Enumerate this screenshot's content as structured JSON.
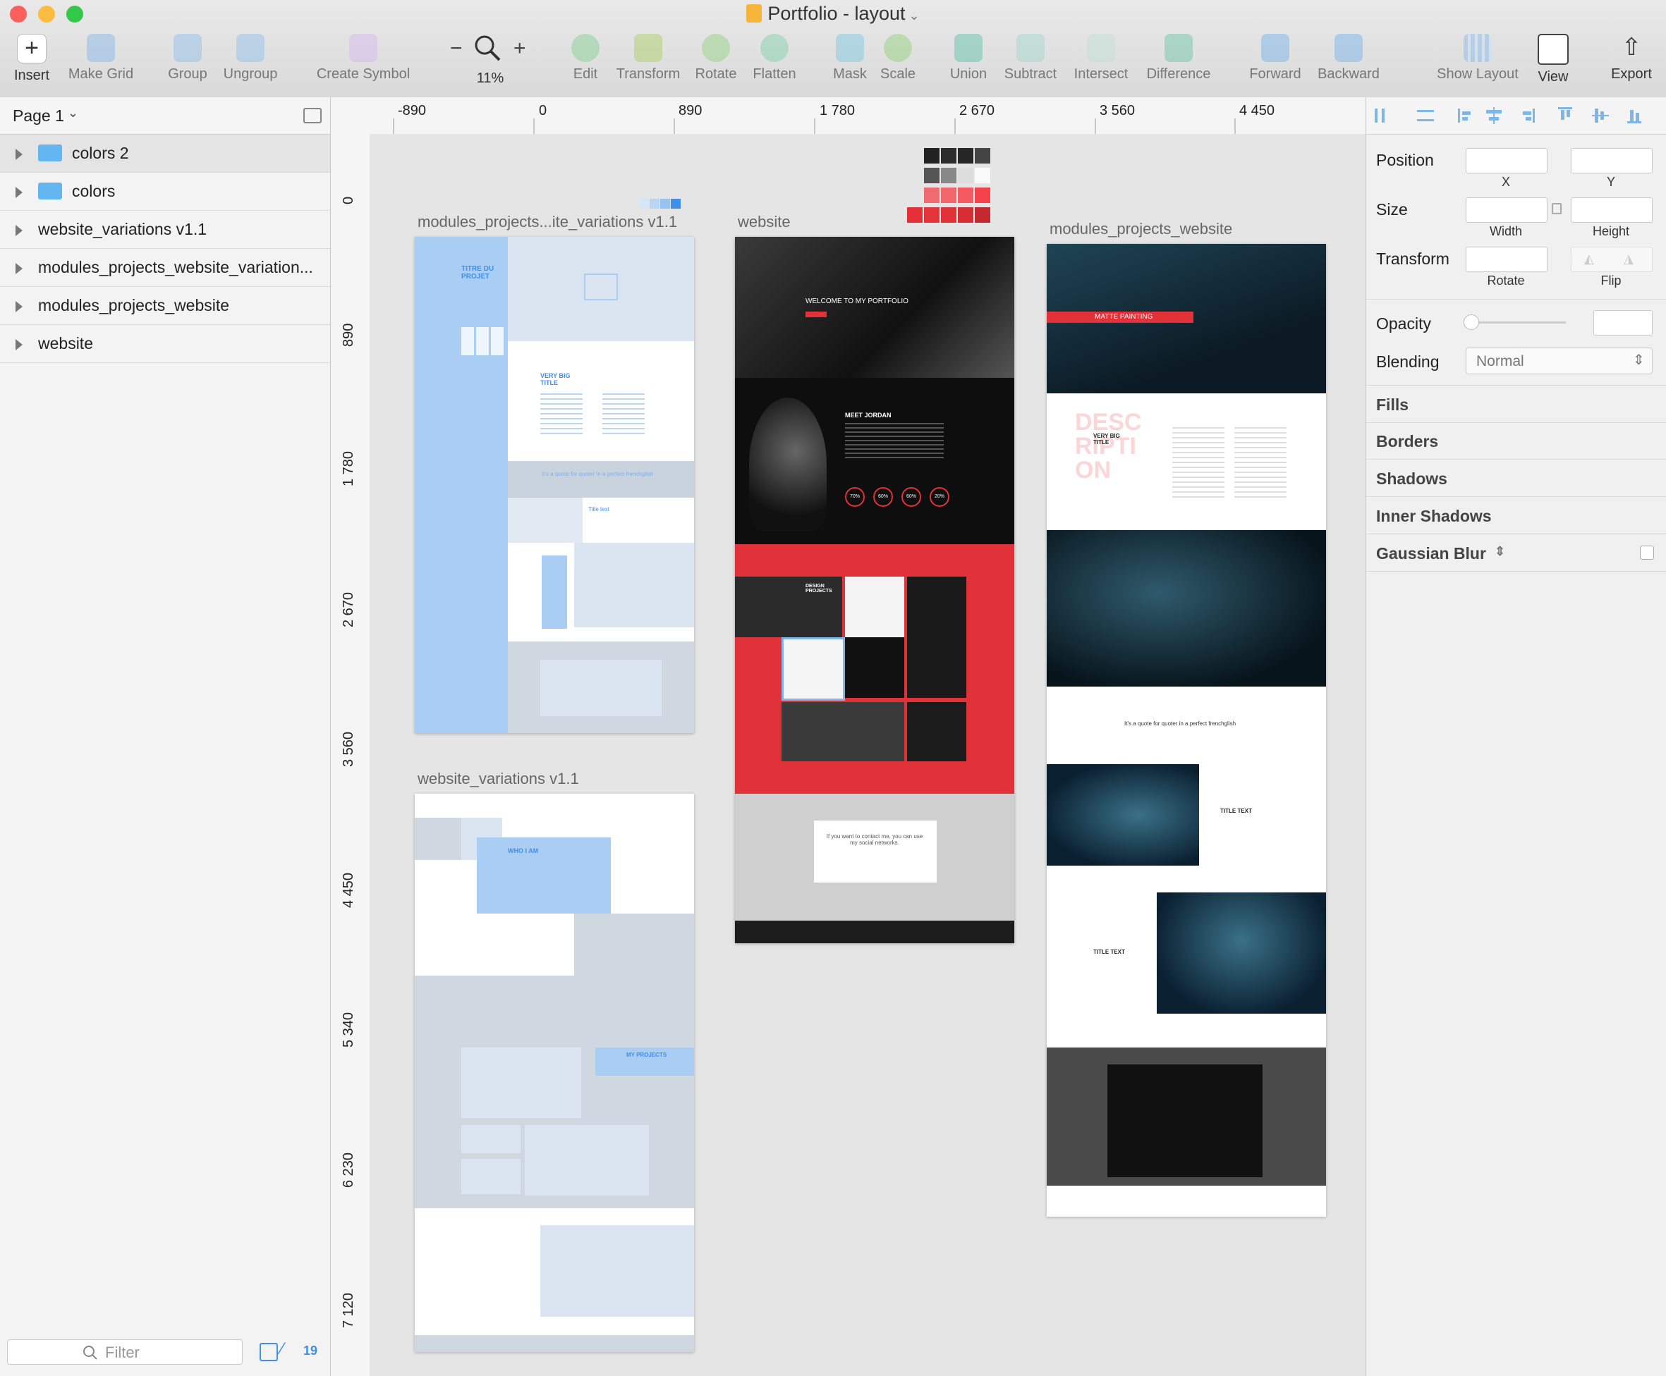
{
  "window": {
    "title": "Portfolio - layout"
  },
  "toolbar": {
    "insert": "Insert",
    "make_grid": "Make Grid",
    "group": "Group",
    "ungroup": "Ungroup",
    "create_symbol": "Create Symbol",
    "zoom_minus": "−",
    "zoom_plus": "+",
    "zoom": "11%",
    "edit": "Edit",
    "transform": "Transform",
    "rotate": "Rotate",
    "flatten": "Flatten",
    "mask": "Mask",
    "scale": "Scale",
    "union": "Union",
    "subtract": "Subtract",
    "intersect": "Intersect",
    "difference": "Difference",
    "forward": "Forward",
    "backward": "Backward",
    "show_layout": "Show Layout",
    "view": "View",
    "export": "Export"
  },
  "sidebar": {
    "page": "Page 1",
    "layers": [
      {
        "label": "colors 2",
        "icon": "folder-icon"
      },
      {
        "label": "colors",
        "icon": "folder-icon"
      },
      {
        "label": "website_variations v1.1"
      },
      {
        "label": "modules_projects_website_variation..."
      },
      {
        "label": "modules_projects_website"
      },
      {
        "label": "website"
      }
    ],
    "filter_placeholder": "Filter",
    "count": "19"
  },
  "rulers": {
    "top": [
      "-890",
      "0",
      "890",
      "1 780",
      "2 670",
      "3 560",
      "4 450"
    ],
    "left": [
      "0",
      "890",
      "1 780",
      "2 670",
      "3 560",
      "4 450",
      "5 340",
      "6 230",
      "7 120"
    ]
  },
  "artboards": {
    "a1": "modules_projects...ite_variations v1.1",
    "a2": "website",
    "a3": "modules_projects_website",
    "a4": "website_variations v1.1"
  },
  "mock": {
    "titre": "TITRE DU PROJET",
    "very": "VERY BIG TITLE",
    "quote": "It's a quote for quoter in a perfect frenchglish",
    "title_text": "Title text",
    "who": "WHO I AM",
    "my_projects": "MY PROJECTS",
    "welcome": "WELCOME TO MY PORTFOLIO",
    "meet": "MEET JORDAN",
    "design": "DESIGN PROJECTS",
    "contact": "If you want to contact me, you can use my social networks.",
    "matte": "MATTE PAINTING",
    "desc": "DESCRIPTION",
    "title_upper": "TITLE TEXT",
    "skills": [
      "70%",
      "60%",
      "60%",
      "20%"
    ]
  },
  "inspector": {
    "position": "Position",
    "x": "X",
    "y": "Y",
    "size": "Size",
    "width": "Width",
    "height": "Height",
    "transform": "Transform",
    "rotate": "Rotate",
    "flip": "Flip",
    "opacity": "Opacity",
    "blending": "Blending",
    "blend_value": "Normal",
    "fills": "Fills",
    "borders": "Borders",
    "shadows": "Shadows",
    "inner_shadows": "Inner Shadows",
    "gaussian_blur": "Gaussian Blur"
  },
  "colors": {
    "accent": "#e03238",
    "blue": "#3f8ee8",
    "light_blue": "#a9cdf3"
  }
}
